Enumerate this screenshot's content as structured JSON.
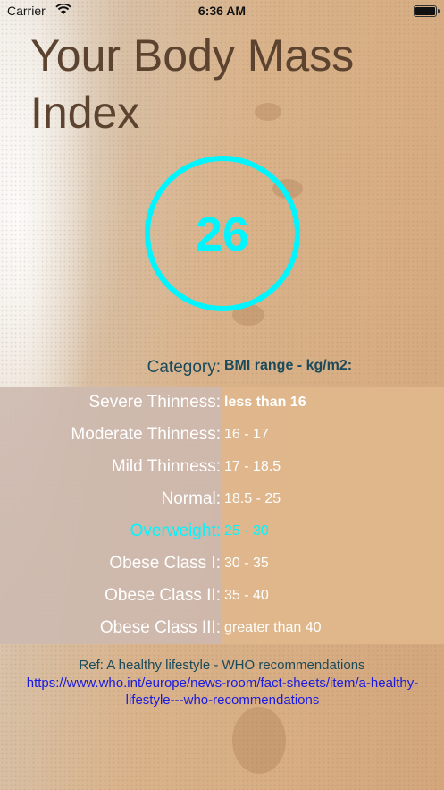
{
  "status_bar": {
    "carrier": "Carrier",
    "time": "6:36 AM"
  },
  "title": "Your Body Mass Index",
  "bmi_value": "26",
  "highlight_color": "#00f5ff",
  "table": {
    "header_category": "Category:",
    "header_range": "BMI range - kg/m2:",
    "rows": [
      {
        "category": "Severe Thinness:",
        "range": "less than 16"
      },
      {
        "category": "Moderate Thinness:",
        "range": "16 - 17"
      },
      {
        "category": "Mild Thinness:",
        "range": "17 - 18.5"
      },
      {
        "category": "Normal:",
        "range": "18.5 - 25"
      },
      {
        "category": "Overweight:",
        "range": "25 - 30",
        "highlighted": true
      },
      {
        "category": "Obese Class I:",
        "range": "30 - 35"
      },
      {
        "category": "Obese Class II:",
        "range": "35 - 40"
      },
      {
        "category": "Obese Class III:",
        "range": "greater than 40"
      }
    ]
  },
  "reference": {
    "text": "Ref: A healthy lifestyle - WHO recommendations",
    "url": "https://www.who.int/europe/news-room/fact-sheets/item/a-healthy-lifestyle---who-recommendations"
  }
}
